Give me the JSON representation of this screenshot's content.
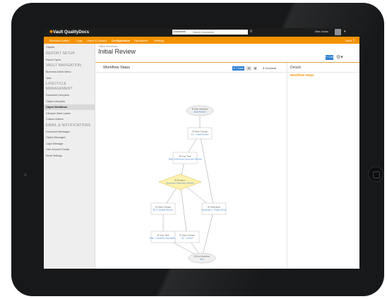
{
  "app": {
    "logo_text": "Vault QualityDocs",
    "logo_mark": "✱"
  },
  "search": {
    "scope": "Documents",
    "placeholder": "Search Documents",
    "icon": "search-icon"
  },
  "user": {
    "name": "Mike Jordan",
    "caret": "▾"
  },
  "nav": {
    "items": [
      {
        "label": "Business Admin"
      },
      {
        "label": "Logs"
      },
      {
        "label": "Users & Groups"
      },
      {
        "label": "Configuration"
      },
      {
        "label": "Operations"
      },
      {
        "label": "Settings"
      }
    ],
    "active_index": 3,
    "help": "Vault ❔"
  },
  "sidebar": {
    "items": [
      {
        "label": "Objects",
        "type": "item"
      },
      {
        "label": "REPORT SETUP",
        "type": "head"
      },
      {
        "label": "Report Types",
        "type": "item"
      },
      {
        "label": "VAULT NAVIGATION",
        "type": "head"
      },
      {
        "label": "Business Admin Menu",
        "type": "item"
      },
      {
        "label": "Tabs",
        "type": "item"
      },
      {
        "label": "LIFECYCLE",
        "type": "head"
      },
      {
        "label": "MANAGEMENT",
        "type": "head"
      },
      {
        "label": "Document Lifecycles",
        "type": "item"
      },
      {
        "label": "Object Lifecycles",
        "type": "item"
      },
      {
        "label": "Object Workflows",
        "type": "item"
      },
      {
        "label": "Lifecycle State Labels",
        "type": "item"
      },
      {
        "label": "Custom Actions",
        "type": "item"
      },
      {
        "label": "EMAIL & NOTIFICATIONS",
        "type": "head"
      },
      {
        "label": "Document Messages",
        "type": "item"
      },
      {
        "label": "Object Messages",
        "type": "item"
      },
      {
        "label": "Login Message",
        "type": "item"
      },
      {
        "label": "User Account Emails",
        "type": "item"
      },
      {
        "label": "Email Settings",
        "type": "item"
      }
    ],
    "active_label": "Object Workflows"
  },
  "page": {
    "breadcrumb": "Object Workflows",
    "title": "Initial Review",
    "edit_label": "✎ Edit",
    "gear": "⚙▾"
  },
  "panel": {
    "title": "Workflow Steps",
    "buttons": [
      {
        "label": "⊕ Create",
        "style": "primary"
      },
      {
        "label": "⊞",
        "style": "toggle"
      },
      {
        "label": "▤",
        "style": "toggle"
      },
      {
        "label": "⬇ Download",
        "style": "plain"
      }
    ]
  },
  "details": {
    "title": "Details",
    "subtitle": "Workflow Steps"
  },
  "diagram": {
    "nodes": [
      {
        "kind": "Start Workflow",
        "name": "Start Review",
        "shape": "ellipse"
      },
      {
        "kind": "State Change",
        "name": "A.1 - Initial Review",
        "shape": "rect"
      },
      {
        "kind": "User Task",
        "name": "Task: Supervisor Document Review",
        "shape": "rect"
      },
      {
        "kind": "Decision",
        "name": "Document Supervisor Review",
        "shape": "diamond"
      },
      {
        "kind": "State Change",
        "name": "B1 to Quality Review",
        "shape": "rect"
      },
      {
        "kind": "Notification",
        "name": "Notification - Please Retry",
        "shape": "rect"
      },
      {
        "kind": "User Task",
        "name": "Task: Complete Investigation",
        "shape": "rect"
      },
      {
        "kind": "State Change",
        "name": "B2 - Closed",
        "shape": "rect"
      },
      {
        "kind": "End Workflow",
        "name": "End",
        "shape": "ellipse"
      }
    ]
  }
}
